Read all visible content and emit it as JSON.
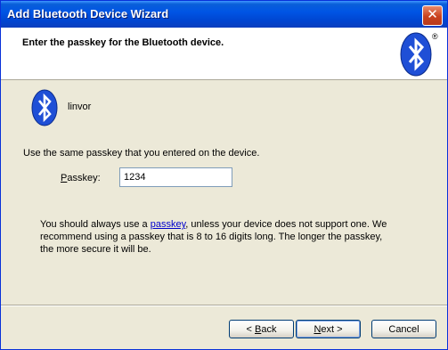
{
  "window": {
    "title": "Add Bluetooth Device Wizard",
    "close_label": "✕"
  },
  "header": {
    "title": "Enter the passkey for the Bluetooth device.",
    "logo_icon": "bluetooth-logo-icon",
    "registered_mark": "®"
  },
  "device": {
    "icon": "bluetooth-device-icon",
    "name": "linvor"
  },
  "instruction": "Use the same passkey that you entered on the device.",
  "passkey": {
    "label_accel": "P",
    "label_rest": "asskey:",
    "value": "1234"
  },
  "note": {
    "before_link": "You should always use a ",
    "link": "passkey",
    "after_link": ", unless your device does not support one. We recommend using a passkey that is 8 to 16 digits long. The longer the passkey, the more secure it will be."
  },
  "buttons": {
    "back_arrow": "< ",
    "back_accel": "B",
    "back_rest": "ack",
    "next_accel": "N",
    "next_rest": "ext",
    "next_arrow": " >",
    "cancel": "Cancel"
  },
  "colors": {
    "titlebar": "#0055e5",
    "dialog_bg": "#ece9d8",
    "bluetooth_blue": "#1f4fd6"
  }
}
